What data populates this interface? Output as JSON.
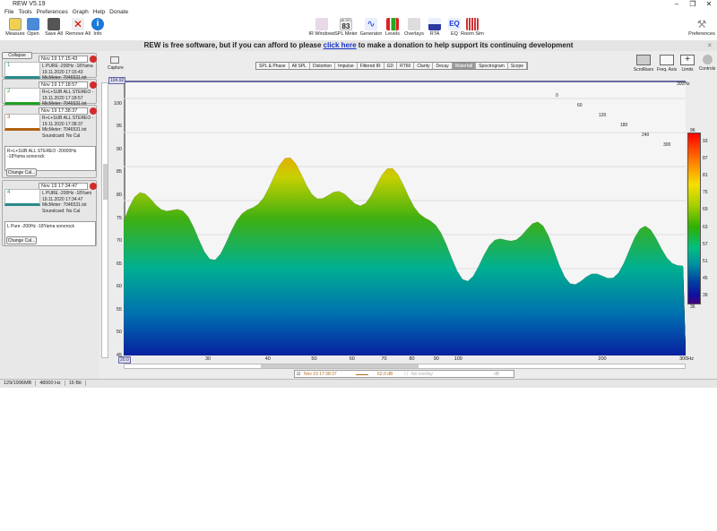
{
  "window": {
    "title": "REW V5.19"
  },
  "menu": [
    "File",
    "Tools",
    "Preferences",
    "Graph",
    "Help",
    "Donate"
  ],
  "toolbar": {
    "left": [
      "Measure",
      "Open",
      "Save All",
      "Remove All",
      "Info"
    ],
    "center": [
      "IR Windows",
      "SPL Meter",
      "Generator",
      "Levels",
      "Overlays",
      "RTA",
      "EQ",
      "Room Sim"
    ],
    "spl_value": "83",
    "spl_unit": "dB SPL",
    "right": "Preferences"
  },
  "banner": {
    "text1": "REW is free software, but if you can afford to please ",
    "link": "click here",
    "text2": " to make a donation to help support its continuing development"
  },
  "left_panel": {
    "collapse": "Collapse",
    "measurements": [
      {
        "num": "1",
        "date": "Nov 19 17:15:43",
        "lines": [
          "L PURE -200Hz -18Yama",
          "19.11.2020 17:15:43",
          "MicMeter: 7046531.txt"
        ]
      },
      {
        "num": "2",
        "date": "Nov 19 17:18:57",
        "lines": [
          "R+L+SUB ALL STEREO -",
          "19.11.2020 17:18:57",
          "MicMeter: 7046531.txt"
        ]
      },
      {
        "num": "3",
        "date": "Nov 19 17:38:37",
        "lines": [
          "R+L+SUB ALL STEREO -",
          "19.11.2020 17:38:37",
          "MicMeter: 7046531.txt",
          "Soundcard: No Cal"
        ],
        "notes": "R+L+SUB ALL STEREO -20000Hz -18Yama sonorock",
        "change": "Change Cal..."
      },
      {
        "num": "4",
        "date": "Nov 19 17:34:47",
        "lines": [
          "L PURE -200Hz -18Yami",
          "19.11.2020 17:34:47",
          "MicMeter: 7046531.txt",
          "Soundcard: No Cal"
        ],
        "notes": "L Pure -200Hz -18Yama sonorock",
        "change": "Change Cal..."
      }
    ]
  },
  "capture": "Capture",
  "tabs": [
    "SPL & Phase",
    "All SPL",
    "Distortion",
    "Impulse",
    "Filtered IR",
    "GD",
    "RT60",
    "Clarity",
    "Decay",
    "Waterfall",
    "Spectrogram",
    "Scope"
  ],
  "active_tab": "Waterfall",
  "right_tools": [
    "Scrollbars",
    "Freq. Axis",
    "Limits",
    "Controls"
  ],
  "graph": {
    "y_top_box": "104.92",
    "y_bottom_box": "20.0",
    "x_left_box": "20.0",
    "y_ticks": [
      "100",
      "95",
      "90",
      "85",
      "80",
      "75",
      "70",
      "65",
      "60",
      "55",
      "50",
      "45"
    ],
    "x_ticks": [
      {
        "f": 30,
        "l": "30"
      },
      {
        "f": 40,
        "l": "40"
      },
      {
        "f": 50,
        "l": "50"
      },
      {
        "f": 60,
        "l": "60"
      },
      {
        "f": 70,
        "l": "70"
      },
      {
        "f": 80,
        "l": "80"
      },
      {
        "f": 90,
        "l": "90"
      },
      {
        "f": 100,
        "l": "100"
      },
      {
        "f": 200,
        "l": "200"
      },
      {
        "f": 300,
        "l": "300Hz"
      }
    ],
    "x_top_right": "300Hz",
    "time_ticks": [
      "0",
      "60",
      "120",
      "180",
      "240",
      "300"
    ],
    "colorbar": [
      "96",
      "93",
      "87",
      "81",
      "75",
      "69",
      "63",
      "57",
      "51",
      "45",
      "39",
      "36"
    ]
  },
  "legend": {
    "name": "Nov 19 17:38:37",
    "value": "62.0 dB",
    "overlay": "No overlay",
    "unit": "dB"
  },
  "status": [
    "129/1996MB",
    "48000 Hz",
    "16 Bit"
  ]
}
